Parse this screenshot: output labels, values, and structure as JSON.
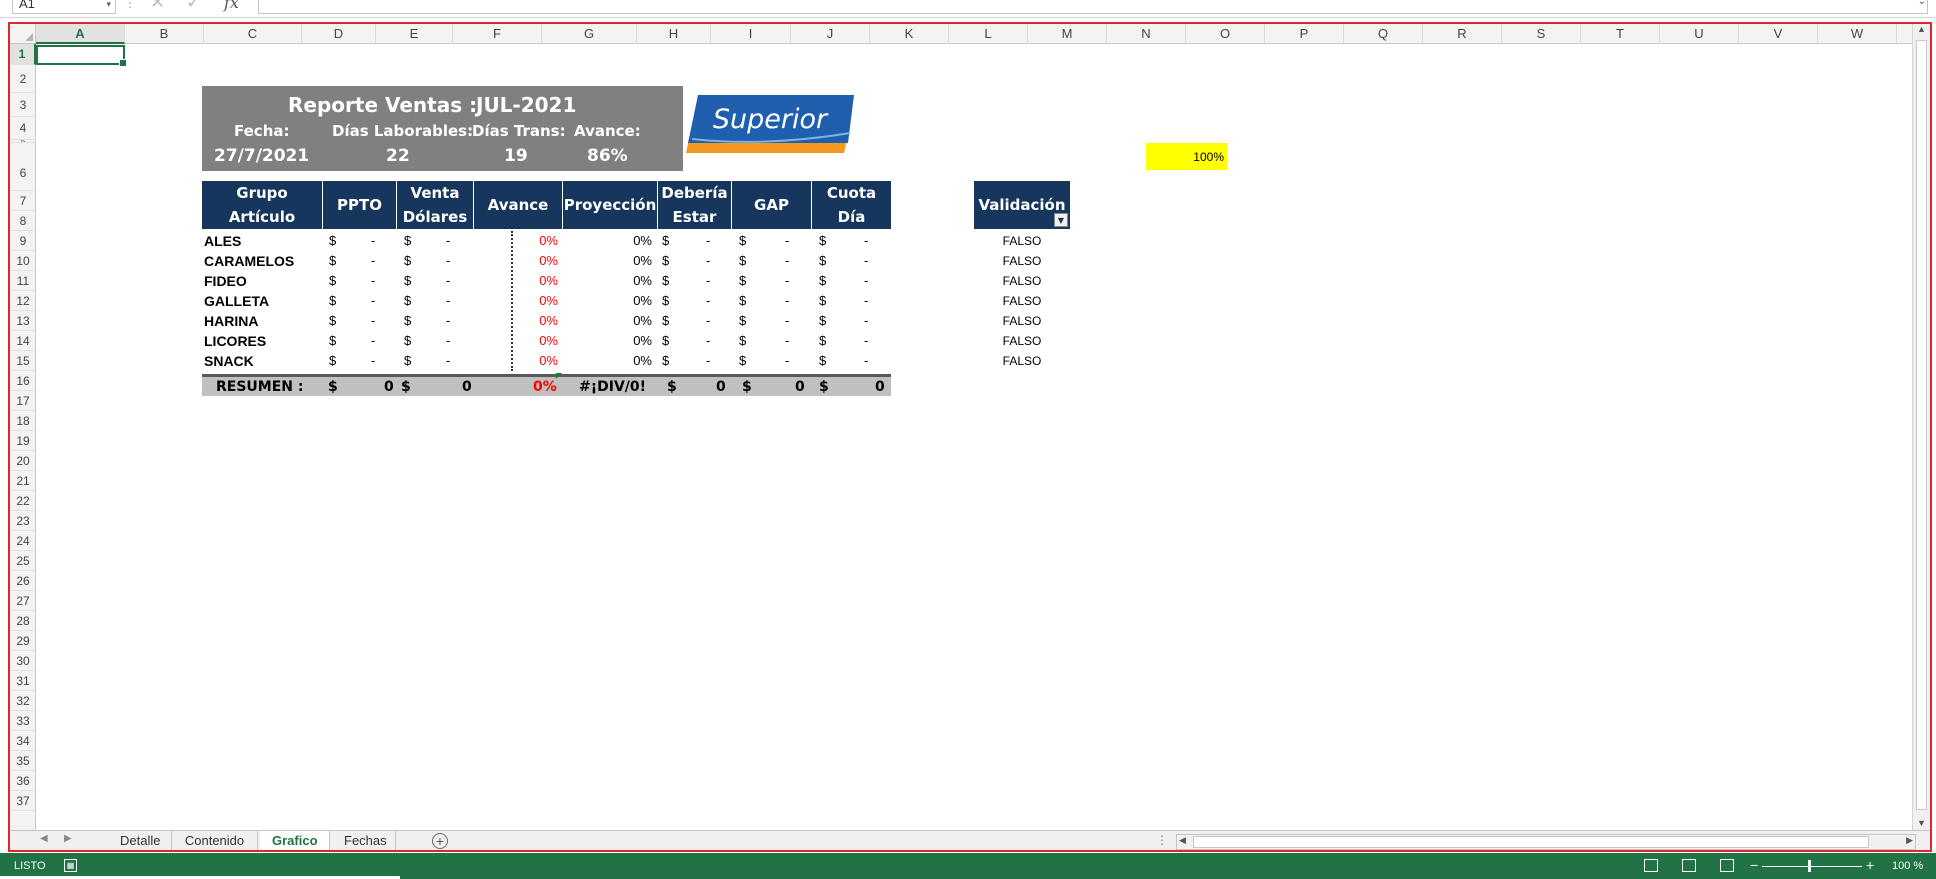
{
  "formula_bar": {
    "name_box": "A1",
    "function_label": "fx",
    "formula": ""
  },
  "columns": [
    "A",
    "B",
    "C",
    "D",
    "E",
    "F",
    "G",
    "H",
    "I",
    "J",
    "K",
    "L",
    "M",
    "N",
    "O",
    "P",
    "Q",
    "R",
    "S",
    "T",
    "U",
    "V",
    "W"
  ],
  "selected_column": "A",
  "selected_row": "1",
  "report": {
    "title": "Reporte Ventas :",
    "period": "JUL-2021",
    "fecha_label": "Fecha:",
    "dias_lab_label": "Días Laborables:",
    "dias_trans_label": "Días Trans:",
    "avance_label": "Avance:",
    "fecha_value": "27/7/2021",
    "dias_lab_value": "22",
    "dias_trans_value": "19",
    "avance_value": "86%"
  },
  "logo": {
    "text": "Superior",
    "colors": {
      "blue": "#1f5fae",
      "orange": "#f39a1e"
    }
  },
  "yellow_cell": "100%",
  "table": {
    "headers": [
      {
        "line1": "Grupo",
        "line2": "Artículo"
      },
      {
        "line1": "PPTO",
        "line2": ""
      },
      {
        "line1": "Venta",
        "line2": "Dólares"
      },
      {
        "line1": "Avance",
        "line2": ""
      },
      {
        "line1": "Proyección",
        "line2": ""
      },
      {
        "line1": "Debería",
        "line2": "Estar"
      },
      {
        "line1": "GAP",
        "line2": ""
      },
      {
        "line1": "Cuota",
        "line2": "Día"
      }
    ],
    "rows": [
      {
        "name": "ALES",
        "ppto": "$",
        "ppto_v": "-",
        "venta": "$",
        "venta_v": "-",
        "avance": "0%",
        "proy": "0%",
        "deb": "$",
        "deb_v": "-",
        "gap": "$",
        "gap_v": "-",
        "cuota": "$",
        "cuota_v": "-"
      },
      {
        "name": "CARAMELOS",
        "ppto": "$",
        "ppto_v": "-",
        "venta": "$",
        "venta_v": "-",
        "avance": "0%",
        "proy": "0%",
        "deb": "$",
        "deb_v": "-",
        "gap": "$",
        "gap_v": "-",
        "cuota": "$",
        "cuota_v": "-"
      },
      {
        "name": "FIDEO",
        "ppto": "$",
        "ppto_v": "-",
        "venta": "$",
        "venta_v": "-",
        "avance": "0%",
        "proy": "0%",
        "deb": "$",
        "deb_v": "-",
        "gap": "$",
        "gap_v": "-",
        "cuota": "$",
        "cuota_v": "-"
      },
      {
        "name": "GALLETA",
        "ppto": "$",
        "ppto_v": "-",
        "venta": "$",
        "venta_v": "-",
        "avance": "0%",
        "proy": "0%",
        "deb": "$",
        "deb_v": "-",
        "gap": "$",
        "gap_v": "-",
        "cuota": "$",
        "cuota_v": "-"
      },
      {
        "name": "HARINA",
        "ppto": "$",
        "ppto_v": "-",
        "venta": "$",
        "venta_v": "-",
        "avance": "0%",
        "proy": "0%",
        "deb": "$",
        "deb_v": "-",
        "gap": "$",
        "gap_v": "-",
        "cuota": "$",
        "cuota_v": "-"
      },
      {
        "name": "LICORES",
        "ppto": "$",
        "ppto_v": "-",
        "venta": "$",
        "venta_v": "-",
        "avance": "0%",
        "proy": "0%",
        "deb": "$",
        "deb_v": "-",
        "gap": "$",
        "gap_v": "-",
        "cuota": "$",
        "cuota_v": "-"
      },
      {
        "name": "SNACK",
        "ppto": "$",
        "ppto_v": "-",
        "venta": "$",
        "venta_v": "-",
        "avance": "0%",
        "proy": "0%",
        "deb": "$",
        "deb_v": "-",
        "gap": "$",
        "gap_v": "-",
        "cuota": "$",
        "cuota_v": "-"
      }
    ],
    "summary": {
      "label": "RESUMEN :",
      "ppto_sym": "$",
      "ppto": "0",
      "venta_sym": "$",
      "venta": "0",
      "avance": "0%",
      "proy": "#¡DIV/0!",
      "deb_sym": "$",
      "deb": "0",
      "gap_sym": "$",
      "gap": "0",
      "cuota_sym": "$",
      "cuota": "0"
    }
  },
  "validation": {
    "header": "Validación",
    "values": [
      "FALSO",
      "FALSO",
      "FALSO",
      "FALSO",
      "FALSO",
      "FALSO",
      "FALSO"
    ]
  },
  "sheet_tabs": [
    "Detalle",
    "Contenido",
    "Grafico",
    "Fechas"
  ],
  "active_tab": "Grafico",
  "status": {
    "ready": "LISTO",
    "zoom": "100 %"
  },
  "colors": {
    "excel_green": "#217346",
    "header_navy": "#17365d",
    "yellow": "#ffff00",
    "red": "#ff0000",
    "frame_red": "#e0252b"
  }
}
